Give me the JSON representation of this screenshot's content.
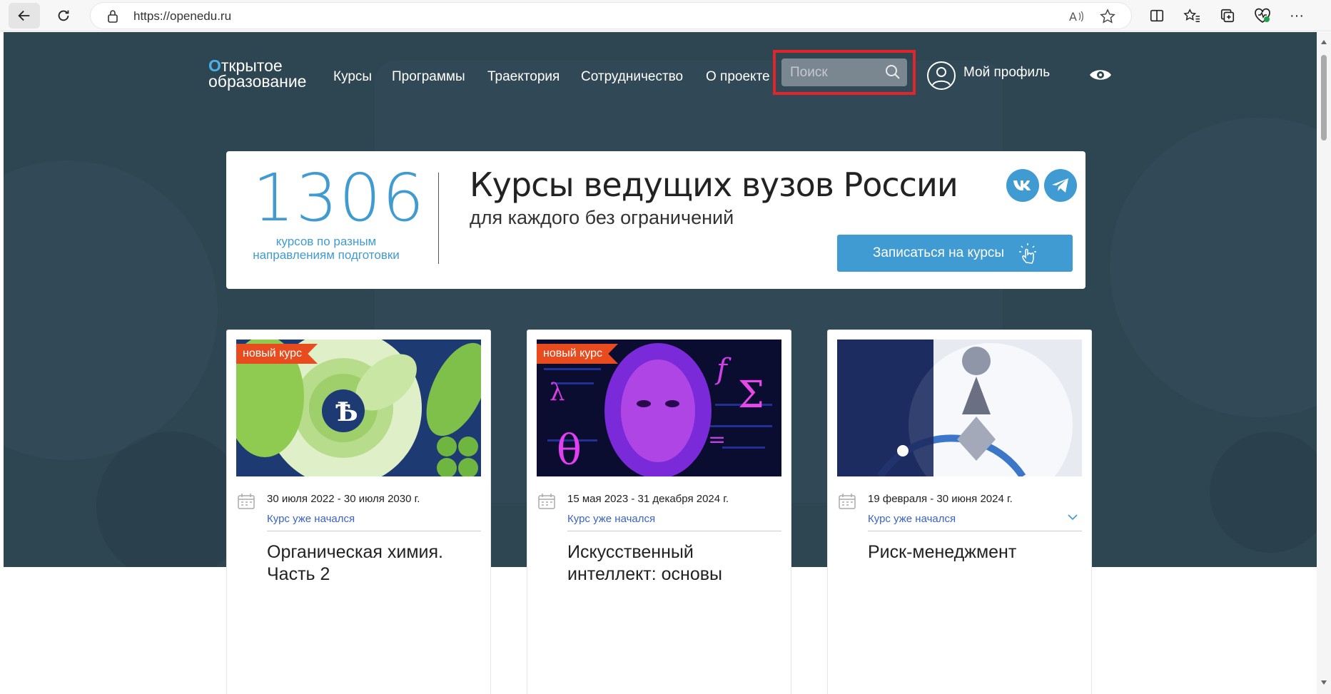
{
  "browser": {
    "url": "https://openedu.ru"
  },
  "header": {
    "logo_line1": "Открытое",
    "logo_line2": "образование",
    "nav": [
      "Курсы",
      "Программы",
      "Траектория",
      "Сотрудничество",
      "О проекте"
    ],
    "search_placeholder": "Поиск",
    "profile_label": "Мой профиль"
  },
  "banner": {
    "count": "1306",
    "count_caption_line1": "курсов по разным",
    "count_caption_line2": "направлениям подготовки",
    "title": "Курсы ведущих вузов России",
    "subtitle": "для каждого без ограничений",
    "enroll_label": "Записаться на курсы"
  },
  "cards": [
    {
      "tag": "новый курс",
      "dates": "30 июля 2022 - 30 июля 2030 г.",
      "status": "Курс уже начался",
      "title": "Органическая химия. Часть 2"
    },
    {
      "tag": "новый курс",
      "dates": "15 мая 2023 - 31 декабря 2024 г.",
      "status": "Курс уже начался",
      "title": "Искусственный интеллект: основы"
    },
    {
      "tag": "",
      "dates": "19 февраля - 30 июня 2024 г.",
      "status": "Курс уже начался",
      "title": "Риск-менеджмент"
    }
  ],
  "colors": {
    "accent": "#3f9bd1",
    "hero": "#2e4552",
    "tag": "#e84c1e",
    "highlight": "#e0262b"
  }
}
